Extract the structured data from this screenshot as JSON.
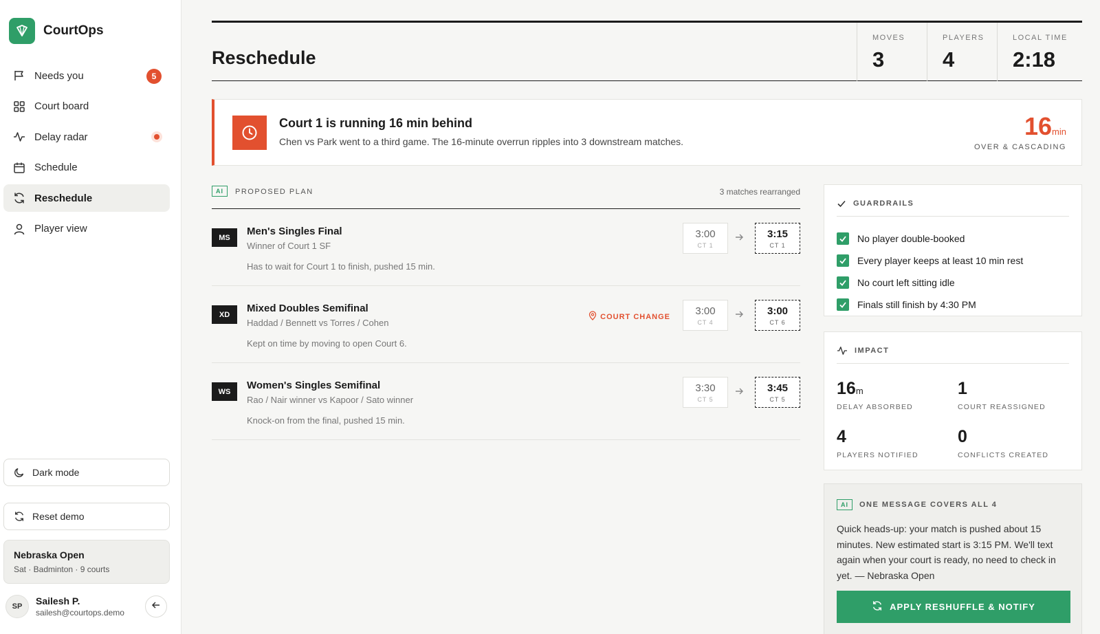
{
  "app": {
    "name": "CourtOps"
  },
  "sidebar": {
    "items": [
      {
        "label": "Needs you",
        "badge": "5"
      },
      {
        "label": "Court board"
      },
      {
        "label": "Delay radar"
      },
      {
        "label": "Schedule"
      },
      {
        "label": "Reschedule",
        "active": true
      },
      {
        "label": "Player view"
      }
    ],
    "dark_mode": "Dark mode",
    "reset_demo": "Reset demo",
    "tournament": {
      "name": "Nebraska Open",
      "meta": "Sat · Badminton · 9 courts"
    },
    "user": {
      "initials": "SP",
      "name": "Sailesh P.",
      "email": "sailesh@courtops.demo"
    }
  },
  "header": {
    "title": "Reschedule",
    "stats": [
      {
        "label": "MOVES",
        "value": "3"
      },
      {
        "label": "PLAYERS",
        "value": "4"
      },
      {
        "label": "LOCAL TIME",
        "value": "2:18"
      }
    ]
  },
  "alert": {
    "title": "Court 1 is running 16 min behind",
    "description": "Chen vs Park went to a third game. The 16-minute overrun ripples into 3 downstream matches.",
    "number": "16",
    "unit": "min",
    "sub": "OVER & CASCADING"
  },
  "plan": {
    "chip": "AI",
    "label": "PROPOSED PLAN",
    "count": "3 matches rearranged",
    "matches": [
      {
        "tag": "MS",
        "title": "Men's Singles Final",
        "sub": "Winner of Court 1 SF",
        "note": "Has to wait for Court 1 to finish, pushed 15 min.",
        "old_time": "3:00",
        "old_ct": "CT 1",
        "new_time": "3:15",
        "new_ct": "CT 1",
        "court_change": ""
      },
      {
        "tag": "XD",
        "title": "Mixed Doubles Semifinal",
        "sub": "Haddad / Bennett vs Torres / Cohen",
        "note": "Kept on time by moving to open Court 6.",
        "old_time": "3:00",
        "old_ct": "CT 4",
        "new_time": "3:00",
        "new_ct": "CT 6",
        "court_change": "COURT CHANGE"
      },
      {
        "tag": "WS",
        "title": "Women's Singles Semifinal",
        "sub": "Rao / Nair winner vs Kapoor / Sato winner",
        "note": "Knock-on from the final, pushed 15 min.",
        "old_time": "3:30",
        "old_ct": "CT 5",
        "new_time": "3:45",
        "new_ct": "CT 5",
        "court_change": ""
      }
    ]
  },
  "guardrails": {
    "label": "GUARDRAILS",
    "items": [
      "No player double-booked",
      "Every player keeps at least 10 min rest",
      "No court left sitting idle",
      "Finals still finish by 4:30 PM"
    ]
  },
  "impact": {
    "label": "IMPACT",
    "items": [
      {
        "value": "16",
        "unit": "m",
        "label": "DELAY ABSORBED"
      },
      {
        "value": "1",
        "unit": "",
        "label": "COURT REASSIGNED"
      },
      {
        "value": "4",
        "unit": "",
        "label": "PLAYERS NOTIFIED"
      },
      {
        "value": "0",
        "unit": "",
        "label": "CONFLICTS CREATED"
      }
    ]
  },
  "message": {
    "chip": "AI",
    "label": "ONE MESSAGE COVERS ALL 4",
    "body": "Quick heads-up: your match is pushed about 15 minutes. New estimated start is 3:15 PM. We'll text again when your court is ready, no need to check in yet. — Nebraska Open",
    "button": "APPLY RESHUFFLE & NOTIFY"
  },
  "colors": {
    "accent": "#2f9e68",
    "alert": "#e2502f"
  }
}
